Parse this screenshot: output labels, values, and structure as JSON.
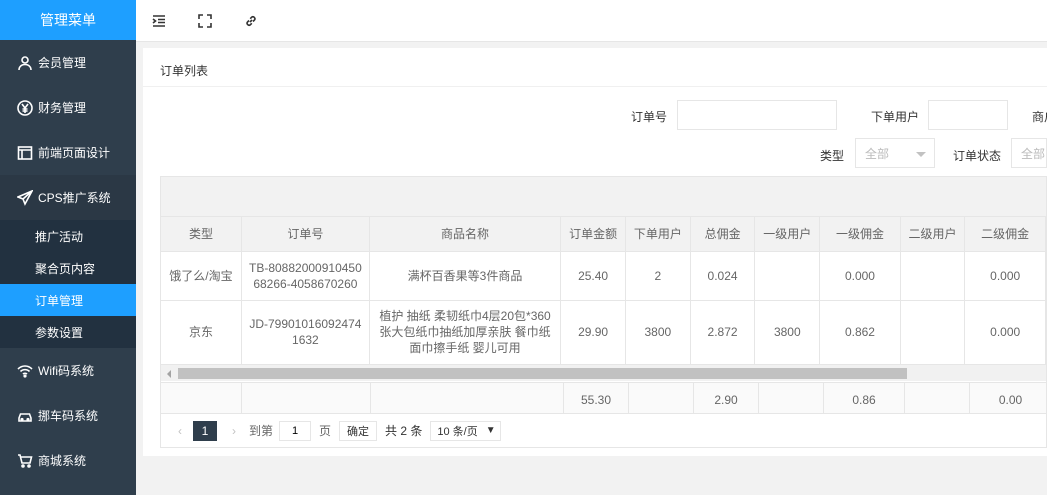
{
  "sidebar": {
    "title": "管理菜单",
    "items": [
      {
        "label": "会员管理"
      },
      {
        "label": "财务管理"
      },
      {
        "label": "前端页面设计"
      },
      {
        "label": "CPS推广系统"
      }
    ],
    "cps_sub": [
      {
        "label": "推广活动"
      },
      {
        "label": "聚合页内容"
      },
      {
        "label": "订单管理"
      },
      {
        "label": "参数设置"
      }
    ],
    "items_after": [
      {
        "label": "Wifi码系统"
      },
      {
        "label": "挪车码系统"
      },
      {
        "label": "商城系统"
      }
    ]
  },
  "card": {
    "title": "订单列表"
  },
  "filters": {
    "order_no_label": "订单号",
    "order_no_value": "",
    "user_label": "下单用户",
    "user_value": "",
    "product_label_partial": "商户",
    "type_label": "类型",
    "type_value": "全部",
    "status_label": "订单状态",
    "status_value": "全部"
  },
  "table": {
    "headers": [
      "类型",
      "订单号",
      "商品名称",
      "订单金额",
      "下单用户",
      "总佣金",
      "一级用户",
      "一级佣金",
      "二级用户",
      "二级佣金"
    ],
    "rows": [
      [
        "饿了么/淘宝",
        "TB-8088200091045068266-4058670260",
        "满杯百香果等3件商品",
        "25.40",
        "2",
        "0.024",
        "",
        "0.000",
        "",
        "0.000"
      ],
      [
        "京东",
        "JD-799010160924741632",
        "植护 抽纸 柔韧纸巾4层20包*360张大包纸巾抽纸加厚亲肤 餐巾纸 面巾擦手纸 婴儿可用",
        "29.90",
        "3800",
        "2.872",
        "3800",
        "0.862",
        "",
        "0.000"
      ]
    ],
    "totals": [
      "55.30",
      "2.90",
      "0.86",
      "0.00"
    ]
  },
  "pager": {
    "prev": "‹",
    "current": "1",
    "next": "›",
    "goto_label": "到第",
    "goto_value": "1",
    "page_unit": "页",
    "confirm": "确定",
    "total": "共 2 条",
    "page_size": "10 条/页"
  },
  "colors": {
    "sidebar_bg": "#2f3e4c",
    "accent": "#1e9fff"
  }
}
